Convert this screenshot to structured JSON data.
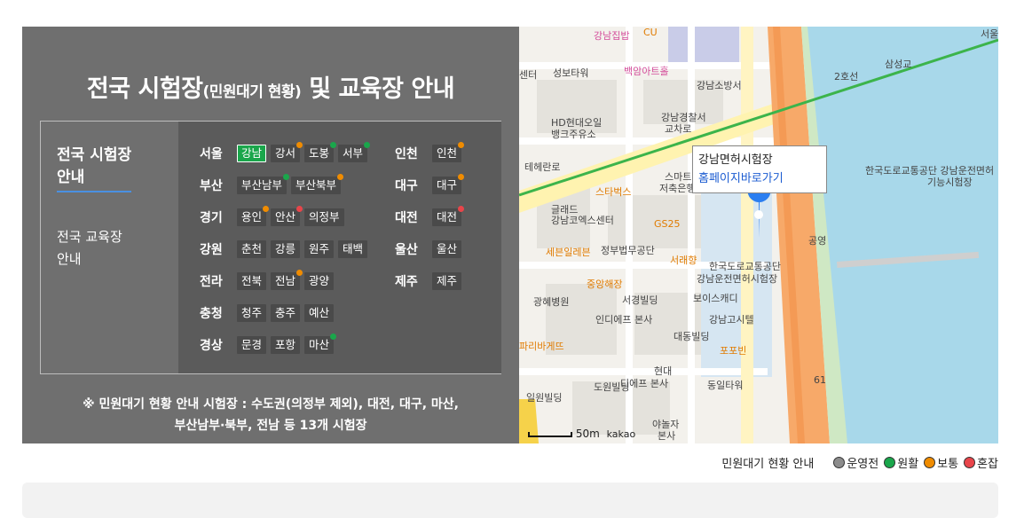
{
  "panel": {
    "title_main_a": "전국 시험장",
    "title_small": "(민원대기 현황)",
    "title_main_b": " 및 교육장 안내",
    "nav_exam_line1": "전국 시험장",
    "nav_exam_line2": "안내",
    "nav_edu_line1": "전국 교육장",
    "nav_edu_line2": "안내",
    "notice_line1": "※ 민원대기 현황 안내 시험장 : 수도권(의정부 제외), 대전, 대구, 마산,",
    "notice_line2": "부산남부·북부, 전남 등 13개 시험장",
    "regions_left": [
      {
        "name": "서울",
        "centers": [
          {
            "label": "강남",
            "status": "active"
          },
          {
            "label": "강서",
            "status": "orange"
          },
          {
            "label": "도봉",
            "status": "green"
          },
          {
            "label": "서부",
            "status": "green"
          }
        ]
      },
      {
        "name": "부산",
        "centers": [
          {
            "label": "부산남부",
            "status": "green"
          },
          {
            "label": "부산북부",
            "status": "orange"
          }
        ]
      },
      {
        "name": "경기",
        "centers": [
          {
            "label": "용인",
            "status": "orange"
          },
          {
            "label": "안산",
            "status": "red"
          },
          {
            "label": "의정부",
            "status": "none"
          }
        ]
      },
      {
        "name": "강원",
        "centers": [
          {
            "label": "춘천",
            "status": "none"
          },
          {
            "label": "강릉",
            "status": "none"
          },
          {
            "label": "원주",
            "status": "none"
          },
          {
            "label": "태백",
            "status": "none"
          }
        ]
      },
      {
        "name": "전라",
        "centers": [
          {
            "label": "전북",
            "status": "none"
          },
          {
            "label": "전남",
            "status": "orange"
          },
          {
            "label": "광양",
            "status": "none"
          }
        ]
      },
      {
        "name": "충청",
        "centers": [
          {
            "label": "청주",
            "status": "none"
          },
          {
            "label": "충주",
            "status": "none"
          },
          {
            "label": "예산",
            "status": "none"
          }
        ]
      },
      {
        "name": "경상",
        "centers": [
          {
            "label": "문경",
            "status": "none"
          },
          {
            "label": "포항",
            "status": "none"
          },
          {
            "label": "마산",
            "status": "green"
          }
        ]
      }
    ],
    "regions_right": [
      {
        "name": "인천",
        "centers": [
          {
            "label": "인천",
            "status": "orange"
          }
        ]
      },
      {
        "name": "대구",
        "centers": [
          {
            "label": "대구",
            "status": "orange"
          }
        ]
      },
      {
        "name": "대전",
        "centers": [
          {
            "label": "대전",
            "status": "red"
          }
        ]
      },
      {
        "name": "울산",
        "centers": [
          {
            "label": "울산",
            "status": "none"
          }
        ]
      },
      {
        "name": "제주",
        "centers": [
          {
            "label": "제주",
            "status": "none"
          }
        ]
      }
    ]
  },
  "status_colors": {
    "gray": "#8c8c8c",
    "green": "#1aa64b",
    "orange": "#f08c00",
    "red": "#e8454a"
  },
  "map": {
    "popup_title": "강남면허시험장",
    "popup_link": "홈페이지바로가기",
    "scale_label": "50m",
    "brand": "kakao",
    "labels": [
      {
        "text": "강남집밥",
        "cls": "pink"
      },
      {
        "text": "CU",
        "cls": "orange"
      },
      {
        "text": "백암아트홀",
        "cls": "pink"
      },
      {
        "text": "성보타워",
        "cls": ""
      },
      {
        "text": "강남소방서",
        "cls": ""
      },
      {
        "text": "HD현대오일",
        "cls": ""
      },
      {
        "text": "뱅크주유소",
        "cls": ""
      },
      {
        "text": "강남경찰서",
        "cls": ""
      },
      {
        "text": "교차로",
        "cls": ""
      },
      {
        "text": "스타벅스",
        "cls": "orange"
      },
      {
        "text": "스마트",
        "cls": ""
      },
      {
        "text": "저축은행",
        "cls": ""
      },
      {
        "text": "글래드",
        "cls": ""
      },
      {
        "text": "강남코엑스센터",
        "cls": ""
      },
      {
        "text": "GS25",
        "cls": "orange"
      },
      {
        "text": "세븐일레븐",
        "cls": "orange"
      },
      {
        "text": "정부법무공단",
        "cls": ""
      },
      {
        "text": "서래향",
        "cls": "orange"
      },
      {
        "text": "중앙해장",
        "cls": "orange"
      },
      {
        "text": "광혜병원",
        "cls": ""
      },
      {
        "text": "서경빌딩",
        "cls": ""
      },
      {
        "text": "보이스캐디",
        "cls": ""
      },
      {
        "text": "인디에프 본사",
        "cls": ""
      },
      {
        "text": "강남고시텔",
        "cls": ""
      },
      {
        "text": "대동빌딩",
        "cls": ""
      },
      {
        "text": "포포빈",
        "cls": "orange"
      },
      {
        "text": "파리바게뜨",
        "cls": "orange"
      },
      {
        "text": "한국도로교통공단",
        "cls": ""
      },
      {
        "text": "강남운전면허시험장",
        "cls": ""
      },
      {
        "text": "공영",
        "cls": ""
      },
      {
        "text": "한국도로교통공단 강남운전면허",
        "cls": ""
      },
      {
        "text": "기능시험장",
        "cls": ""
      },
      {
        "text": "현대",
        "cls": ""
      },
      {
        "text": "디에프 본사",
        "cls": ""
      },
      {
        "text": "도원빌딩",
        "cls": ""
      },
      {
        "text": "동일타워",
        "cls": ""
      },
      {
        "text": "일원빌딩",
        "cls": ""
      },
      {
        "text": "야놀자",
        "cls": ""
      },
      {
        "text": "본사",
        "cls": ""
      },
      {
        "text": "2호선",
        "cls": ""
      },
      {
        "text": "삼성교",
        "cls": ""
      },
      {
        "text": "서울",
        "cls": ""
      },
      {
        "text": "테헤란로",
        "cls": ""
      },
      {
        "text": "61",
        "cls": ""
      },
      {
        "text": "센터",
        "cls": ""
      }
    ]
  },
  "legend": {
    "label": "민원대기 현황 안내",
    "items": [
      {
        "label": "운영전",
        "color": "#8c8c8c"
      },
      {
        "label": "원활",
        "color": "#1aa64b"
      },
      {
        "label": "보통",
        "color": "#f08c00"
      },
      {
        "label": "혼잡",
        "color": "#e8454a"
      }
    ]
  }
}
